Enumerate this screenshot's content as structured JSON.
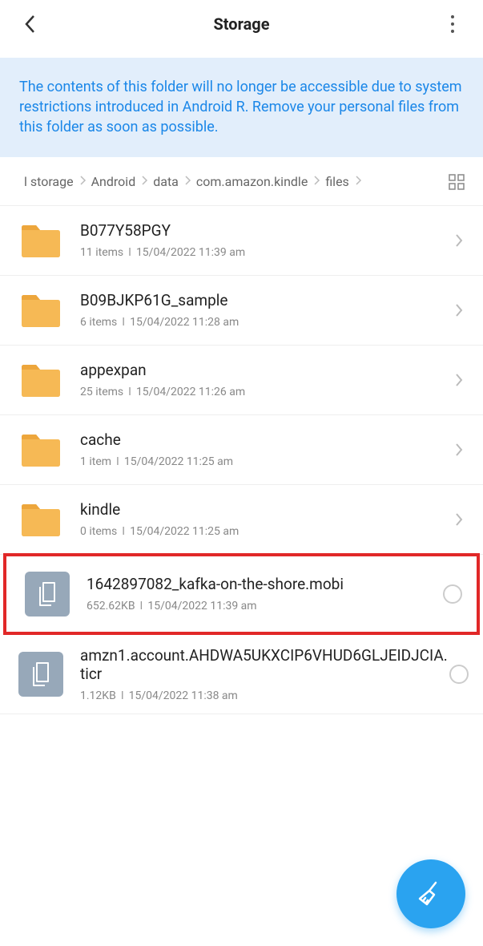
{
  "header": {
    "title": "Storage"
  },
  "banner": {
    "text": "The contents of this folder will no longer be accessible due to system restrictions introduced in Android R. Remove your personal files from this folder as soon as possible."
  },
  "breadcrumb": {
    "items": [
      "l storage",
      "Android",
      "data",
      "com.amazon.kindle",
      "files"
    ]
  },
  "entries": [
    {
      "type": "folder",
      "name": "B077Y58PGY",
      "meta1": "11 items",
      "meta2": "15/04/2022 11:39 am",
      "highlight": false
    },
    {
      "type": "folder",
      "name": "B09BJKP61G_sample",
      "meta1": "6 items",
      "meta2": "15/04/2022 11:28 am",
      "highlight": false
    },
    {
      "type": "folder",
      "name": "appexpan",
      "meta1": "25 items",
      "meta2": "15/04/2022 11:26 am",
      "highlight": false
    },
    {
      "type": "folder",
      "name": "cache",
      "meta1": "1 item",
      "meta2": "15/04/2022 11:25 am",
      "highlight": false
    },
    {
      "type": "folder",
      "name": "kindle",
      "meta1": "0 items",
      "meta2": "15/04/2022 11:25 am",
      "highlight": false
    },
    {
      "type": "file",
      "name": "1642897082_kafka-on-the-shore.mobi",
      "meta1": "652.62KB",
      "meta2": "15/04/2022 11:39 am",
      "highlight": true
    },
    {
      "type": "file",
      "name": "amzn1.account.AHDWA5UKXCIP6VHUD6GLJEIDJCIA.ticr",
      "meta1": "1.12KB",
      "meta2": "15/04/2022 11:38 am",
      "highlight": false
    }
  ]
}
